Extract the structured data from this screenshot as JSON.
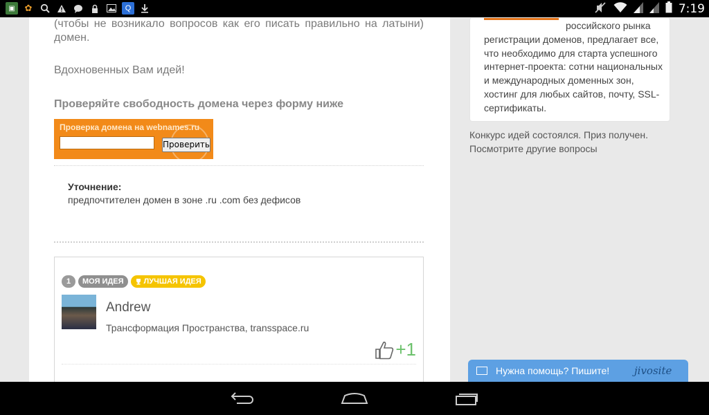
{
  "status_bar": {
    "time": "7:19",
    "left_icons": [
      "app-icon",
      "squirrel-icon",
      "search-icon",
      "warning-icon",
      "chat-bubble-icon",
      "lock-icon",
      "image-icon",
      "q-icon",
      "download-icon"
    ],
    "right_icons": [
      "mute-icon",
      "wifi-icon",
      "signal-icon",
      "signal-icon",
      "battery-icon"
    ]
  },
  "main": {
    "intro": "(чтобы не возникало вопросов как его писать правильно на латыни) домен.",
    "wish": "Вдохновенных Вам идей!",
    "check_title": "Проверяйте свободность домена через форму ниже",
    "domain_widget": {
      "title": "Проверка  домена на webnames.ru",
      "input_value": "",
      "button": "Проверить"
    },
    "clarification": {
      "title": "Уточнение:",
      "text": "предпочтителен домен в зоне .ru .com без дефисов"
    },
    "idea": {
      "number": "1",
      "badge_mine": "МОЯ ИДЕЯ",
      "badge_best": "ЛУЧШАЯ ИДЕЯ",
      "author": "Andrew",
      "company": "Трансформация Пространства, transspace.ru",
      "likes": "+1"
    }
  },
  "sidebar": {
    "promo_first": "российского рынка",
    "promo_rest": "регистрации доменов, предлагает все, что необходимо для старта успешного интернет-проекта: сотни национальных и международных доменных зон, хостинг для любых сайтов, почту, SSL-сертификаты.",
    "contest_line1": "Конкурс идей состоялся. Приз получен.",
    "contest_line2": "Посмотрите другие вопросы"
  },
  "chat": {
    "label": "Нужна помощь? Пишите!",
    "logo": "jivosite"
  },
  "colors": {
    "widget_orange": "#f28a19",
    "best_badge": "#f5c400",
    "like_green": "#6cc16c",
    "chat_blue": "#5da0e3"
  }
}
